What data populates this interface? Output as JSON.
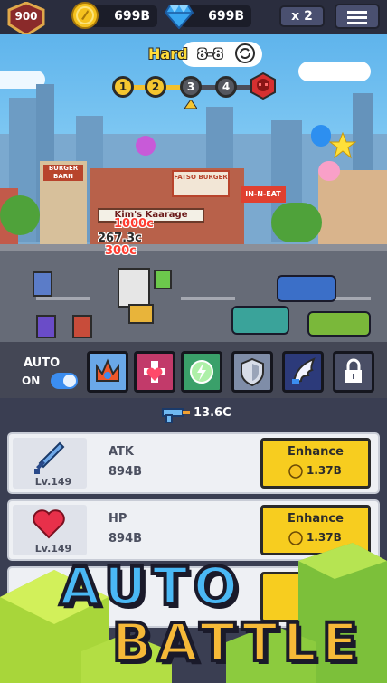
{
  "player": {
    "level": "900"
  },
  "currency": {
    "coins": "699B",
    "gems": "699B"
  },
  "controls": {
    "speed_label": "x 2"
  },
  "stage": {
    "difficulty": "Hard",
    "value": "8-8",
    "nodes": [
      "1",
      "2",
      "3",
      "4"
    ],
    "current_index": 3
  },
  "scene": {
    "signs": {
      "burger_barn": "BURGER BARN",
      "kims_karage": "Kim's Kaarage",
      "fatsos_burger": "FATSO BURGER",
      "in_n_eat": "IN-N-EAT"
    },
    "damage_numbers": [
      "1000c",
      "267.3c",
      "300c"
    ]
  },
  "auto": {
    "label": "AUTO",
    "state": "ON"
  },
  "skills": [
    "flame-crown-skill",
    "heart-cross-skill",
    "lightning-orb-skill",
    "shield-skill",
    "wing-skill",
    "locked-skill"
  ],
  "dps": {
    "value": "13.6C"
  },
  "upgrades": [
    {
      "name": "ATK",
      "value": "894B",
      "level": "Lv.149",
      "button": "Enhance",
      "cost": "1.37B",
      "icon": "sword-icon"
    },
    {
      "name": "HP",
      "value": "894B",
      "level": "Lv.149",
      "button": "Enhance",
      "cost": "1.37B",
      "icon": "heart-icon"
    },
    {
      "name": "",
      "value": "",
      "level": "",
      "button": "E",
      "cost": "",
      "icon": ""
    }
  ],
  "banner": {
    "line1": "AUTO",
    "line2": "BATTLE"
  },
  "colors": {
    "accent_yellow": "#f7cd1f",
    "panel": "#3a3e52",
    "topbar": "#2a2d3e",
    "toggle_on": "#3b8df0",
    "banner_text": "#4ab8f5"
  }
}
